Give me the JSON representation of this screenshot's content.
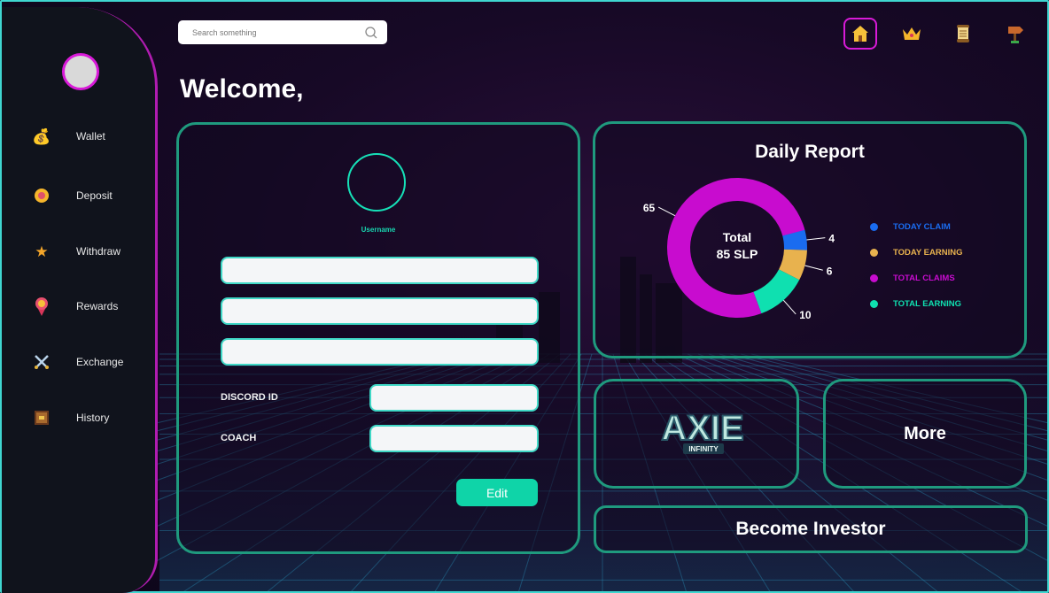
{
  "search": {
    "placeholder": "Search something"
  },
  "sidebar": {
    "items": [
      {
        "label": "Wallet",
        "icon": "money-bag-icon"
      },
      {
        "label": "Deposit",
        "icon": "coin-icon"
      },
      {
        "label": "Withdraw",
        "icon": "star-icon"
      },
      {
        "label": "Rewards",
        "icon": "medal-icon"
      },
      {
        "label": "Exchange",
        "icon": "crossed-swords-icon"
      },
      {
        "label": "History",
        "icon": "book-icon"
      }
    ]
  },
  "topbar": {
    "icons": [
      "home-icon",
      "crown-icon",
      "scroll-icon",
      "signpost-icon"
    ],
    "active": "home-icon"
  },
  "welcome": "Welcome,",
  "profile": {
    "username_label": "Username",
    "discord_label": "DISCORD ID",
    "coach_label": "COACH",
    "edit_label": "Edit"
  },
  "report": {
    "title": "Daily Report",
    "center_line1": "Total",
    "center_line2": "85 SLP",
    "chart_data": {
      "type": "pie",
      "title": "Daily Report",
      "slices": [
        {
          "name": "TODAY CLAIM",
          "value": 4,
          "color": "#1a6cf0"
        },
        {
          "name": "TODAY EARNING",
          "value": 6,
          "color": "#e8b24e"
        },
        {
          "name": "TOTAL EARNING",
          "value": 10,
          "color": "#0fe0b0"
        },
        {
          "name": "TOTAL CLAIMS",
          "value": 65,
          "color": "#c80ccf"
        }
      ],
      "total": "85 SLP",
      "legend_placement": "right"
    },
    "legend": [
      {
        "label": "TODAY CLAIM",
        "color": "#1a6cf0"
      },
      {
        "label": "TODAY EARNING",
        "color": "#e8b24e"
      },
      {
        "label": "TOTAL CLAIMS",
        "color": "#c80ccf"
      },
      {
        "label": "TOTAL EARNING",
        "color": "#0fe0b0"
      }
    ]
  },
  "axie": {
    "logo_top": "AXIE",
    "logo_bottom": "INFINITY"
  },
  "more_label": "More",
  "investor_label": "Become Investor",
  "colors": {
    "accent_teal": "#16e0b7",
    "accent_magenta": "#d81ad8",
    "sidebar_bg": "#10131c"
  }
}
